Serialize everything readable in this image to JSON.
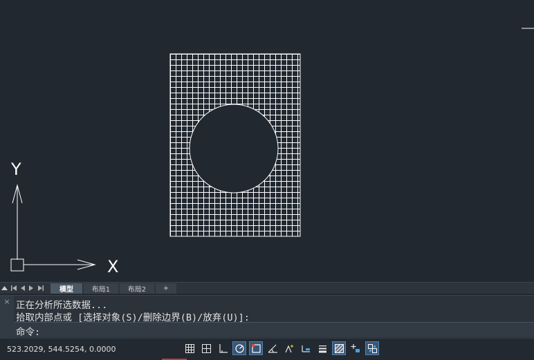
{
  "canvas": {
    "ucs_y_label": "Y",
    "ucs_x_label": "X"
  },
  "layout_tabs": {
    "model": "模型",
    "layout1": "布局1",
    "layout2": "布局2",
    "add": "+"
  },
  "command": {
    "close_glyph": "×",
    "line1": "正在分析所选数据...",
    "line2": "拾取内部点或 [选择对象(S)/删除边界(B)/放弃(U)]:",
    "prompt": "命令:"
  },
  "status_bar": {
    "coordinates": "523.2029, 544.5254, 0.0000",
    "icons": [
      {
        "name": "grid-display-icon",
        "on": false
      },
      {
        "name": "snap-mode-icon",
        "on": false
      },
      {
        "name": "ortho-mode-icon",
        "on": false
      },
      {
        "name": "polar-tracking-icon",
        "on": true
      },
      {
        "name": "object-snap-icon",
        "on": true
      },
      {
        "name": "object-snap-tracking-icon",
        "on": false
      },
      {
        "name": "dynamic-ucs-icon",
        "on": false
      },
      {
        "name": "dynamic-input-icon",
        "on": false
      },
      {
        "name": "lineweight-icon",
        "on": false
      },
      {
        "name": "transparency-icon",
        "on": true
      },
      {
        "name": "selection-cycling-icon",
        "on": false
      },
      {
        "name": "annotation-monitor-icon",
        "on": true
      }
    ]
  },
  "colors": {
    "canvas_bg": "#212830",
    "hatch": "#ffffff",
    "active_tab": "#4b5866",
    "toggle_on": "#3a5675"
  }
}
